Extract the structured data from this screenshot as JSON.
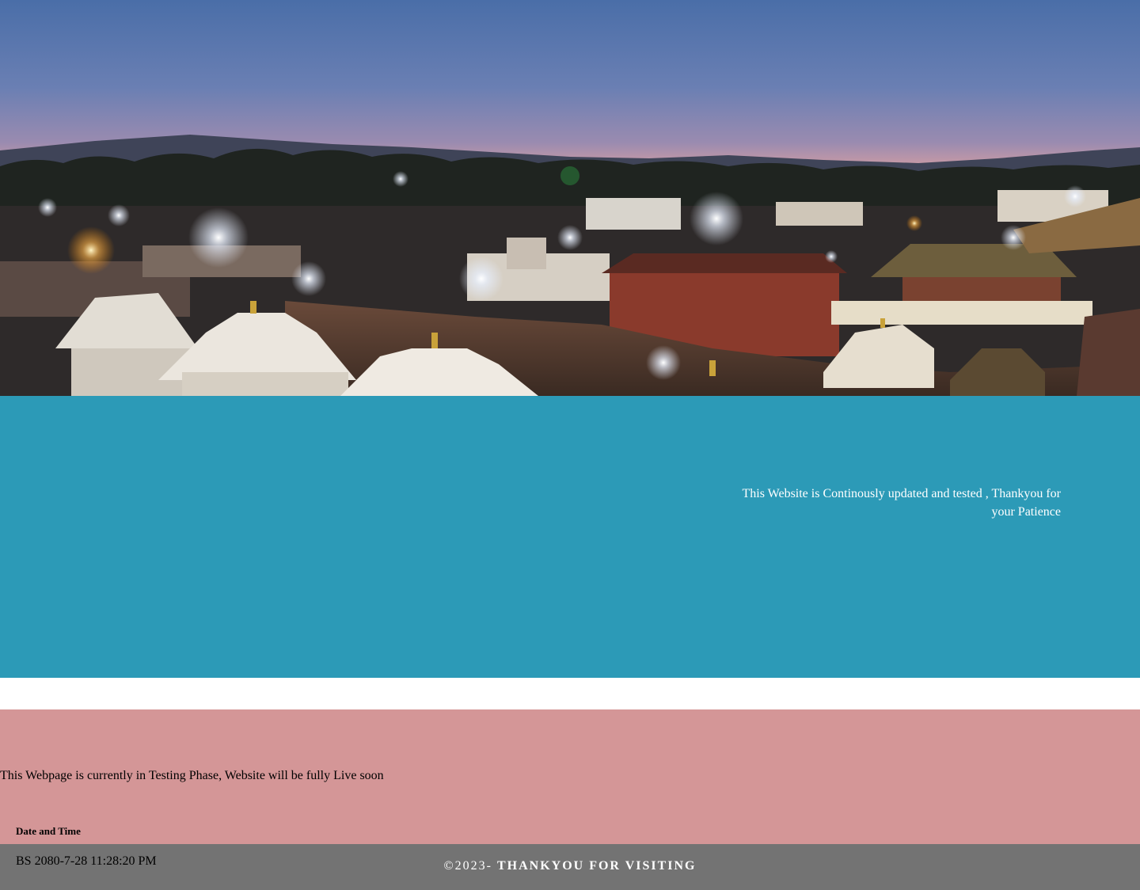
{
  "notice": {
    "text": "This Website is Continously updated and tested , Thankyou for your Patience"
  },
  "status": {
    "testing_text": "This Webpage is currently in Testing Phase, Website will be fully Live soon"
  },
  "datetime": {
    "label": "Date and Time",
    "value": "BS 2080-7-28 11:28:20 PM"
  },
  "footer": {
    "copyright": "©2023- ",
    "message": "THANKYOU FOR VISITING"
  },
  "colors": {
    "band": "#2c9ab7",
    "pink": "#d49697",
    "footer": "#737373"
  }
}
